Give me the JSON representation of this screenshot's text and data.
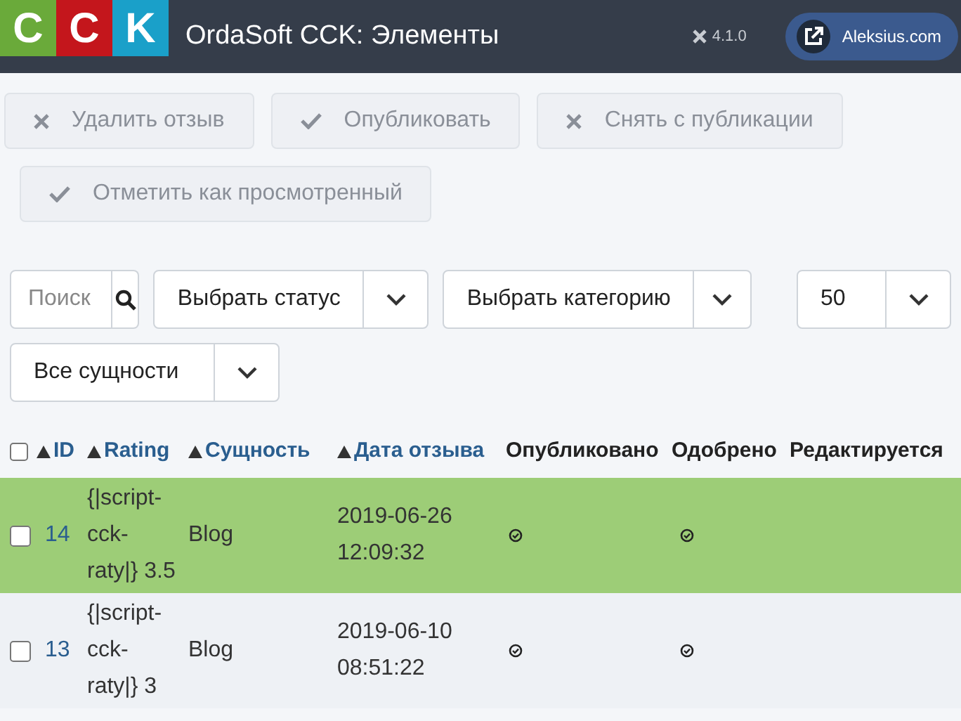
{
  "header": {
    "logo_letters": [
      "C",
      "C",
      "K"
    ],
    "title": "OrdaSoft CCK: Элементы",
    "version": "4.1.0",
    "user_button": "Aleksius.com"
  },
  "toolbar": [
    {
      "label": "Удалить отзыв",
      "kind": "cross"
    },
    {
      "label": "Опубликовать",
      "kind": "check"
    },
    {
      "label": "Снять с публикации",
      "kind": "cross"
    },
    {
      "label": "Отметить как просмотренный",
      "kind": "check"
    }
  ],
  "filters": {
    "search": {
      "placeholder": "Поиск"
    },
    "status": "Выбрать статус",
    "category": "Выбрать категорию",
    "limit": "50",
    "entity": "Все сущности"
  },
  "table": {
    "select_all_checked": false,
    "columns": [
      {
        "label": "ID",
        "sortable": true
      },
      {
        "label": "Rating",
        "sortable": true
      },
      {
        "label": "Сущность",
        "sortable": true
      },
      {
        "label": "Дата отзыва",
        "sortable": true
      },
      {
        "label": "Опубликовано",
        "sortable": false
      },
      {
        "label": "Одобрено",
        "sortable": false
      },
      {
        "label": "Редактируется",
        "sortable": false
      }
    ],
    "rows": [
      {
        "id": "14",
        "rating": "{|script-cck-raty|} 3.5",
        "entity": "Blog",
        "date": "2019-06-26 12:09:32",
        "published": true,
        "approved": true,
        "highlighted": true,
        "checked": false
      },
      {
        "id": "13",
        "rating": "{|script-cck-raty|} 3",
        "entity": "Blog",
        "date": "2019-06-10 08:51:22",
        "published": true,
        "approved": true,
        "highlighted": false,
        "checked": false
      }
    ]
  }
}
